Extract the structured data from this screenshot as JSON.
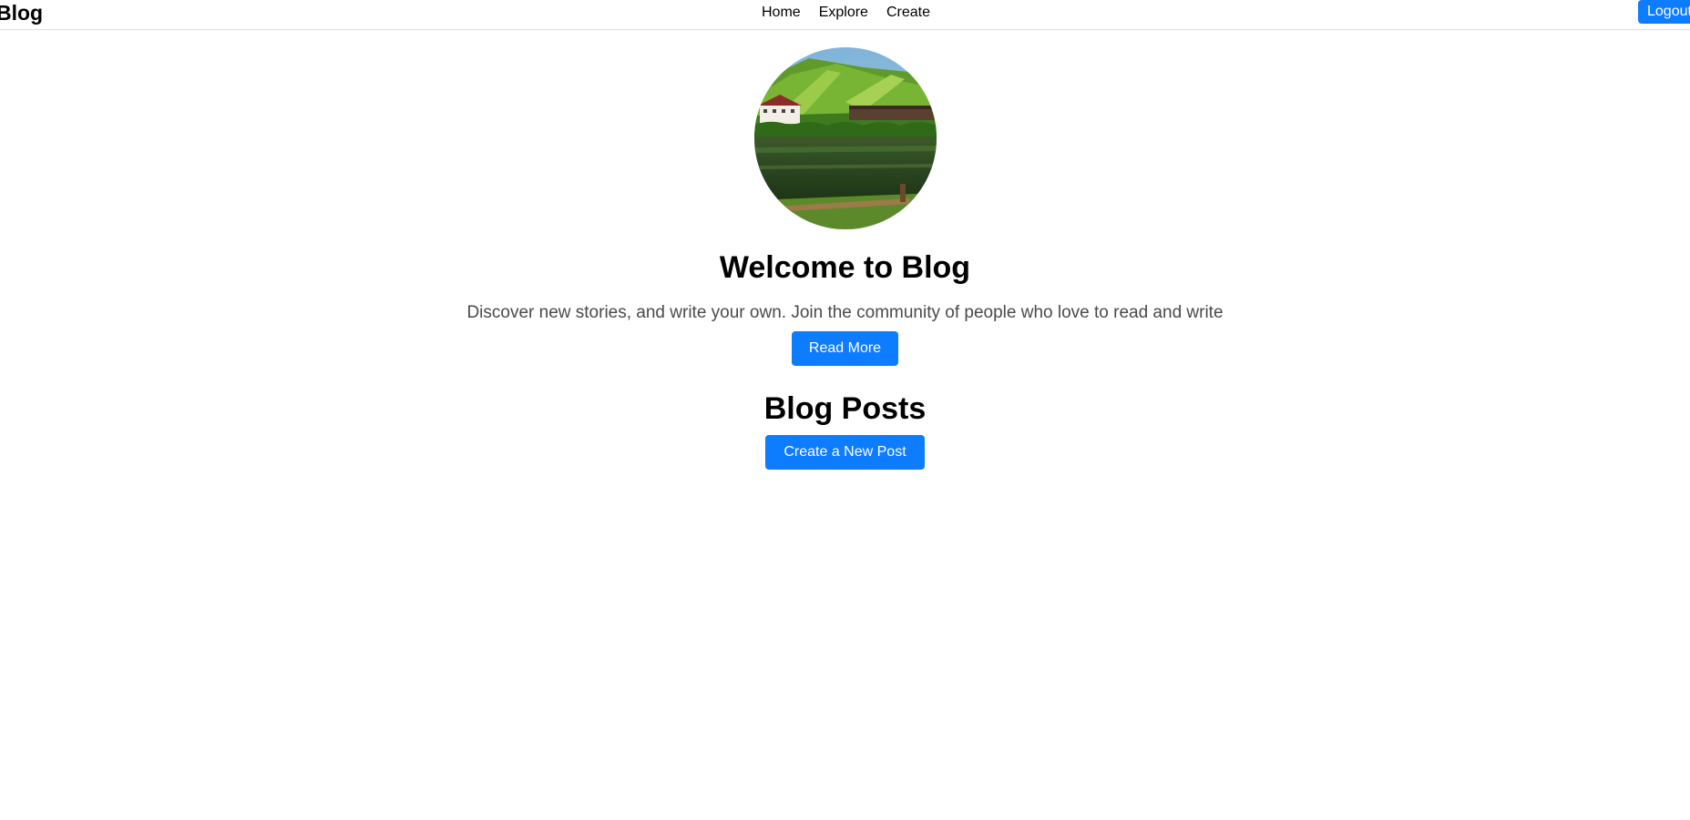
{
  "nav": {
    "brand": "Blog",
    "links": [
      "Home",
      "Explore",
      "Create"
    ],
    "logout_label": "Logout"
  },
  "hero": {
    "avatar_icon": "landscape-photo-icon",
    "title": "Welcome to Blog",
    "subtitle": "Discover new stories, and write your own. Join the community of people who love to read and write",
    "read_more_label": "Read More"
  },
  "posts": {
    "title": "Blog Posts",
    "create_label": "Create a New Post"
  },
  "colors": {
    "accent": "#0d7cff",
    "subtitle_text": "#4a4a4a"
  }
}
